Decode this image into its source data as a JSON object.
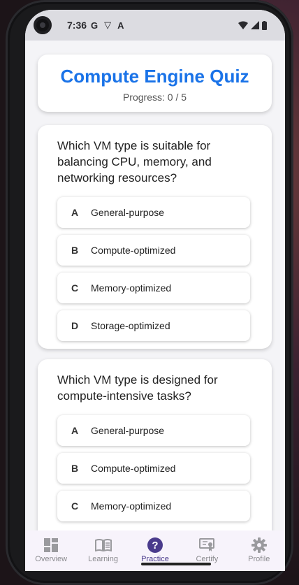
{
  "status": {
    "time": "7:36",
    "left_icons": [
      "G",
      "▽",
      "A"
    ]
  },
  "header": {
    "title": "Compute Engine Quiz",
    "progress": "Progress: 0 / 5"
  },
  "questions": [
    {
      "text": "Which VM type is suitable for balancing CPU, memory, and networking resources?",
      "options": [
        {
          "letter": "A",
          "label": "General-purpose"
        },
        {
          "letter": "B",
          "label": "Compute-optimized"
        },
        {
          "letter": "C",
          "label": "Memory-optimized"
        },
        {
          "letter": "D",
          "label": "Storage-optimized"
        }
      ]
    },
    {
      "text": "Which VM type is designed for compute-intensive tasks?",
      "options": [
        {
          "letter": "A",
          "label": "General-purpose"
        },
        {
          "letter": "B",
          "label": "Compute-optimized"
        },
        {
          "letter": "C",
          "label": "Memory-optimized"
        }
      ]
    }
  ],
  "nav": {
    "active": "Practice",
    "items": [
      {
        "label": "Overview",
        "icon": "dashboard-icon"
      },
      {
        "label": "Learning",
        "icon": "book-icon"
      },
      {
        "label": "Practice",
        "icon": "help-circle-icon"
      },
      {
        "label": "Certify",
        "icon": "certificate-icon"
      },
      {
        "label": "Profile",
        "icon": "gear-icon"
      }
    ]
  },
  "colors": {
    "accent": "#1a73e8",
    "nav_active": "#4a3b8c"
  }
}
